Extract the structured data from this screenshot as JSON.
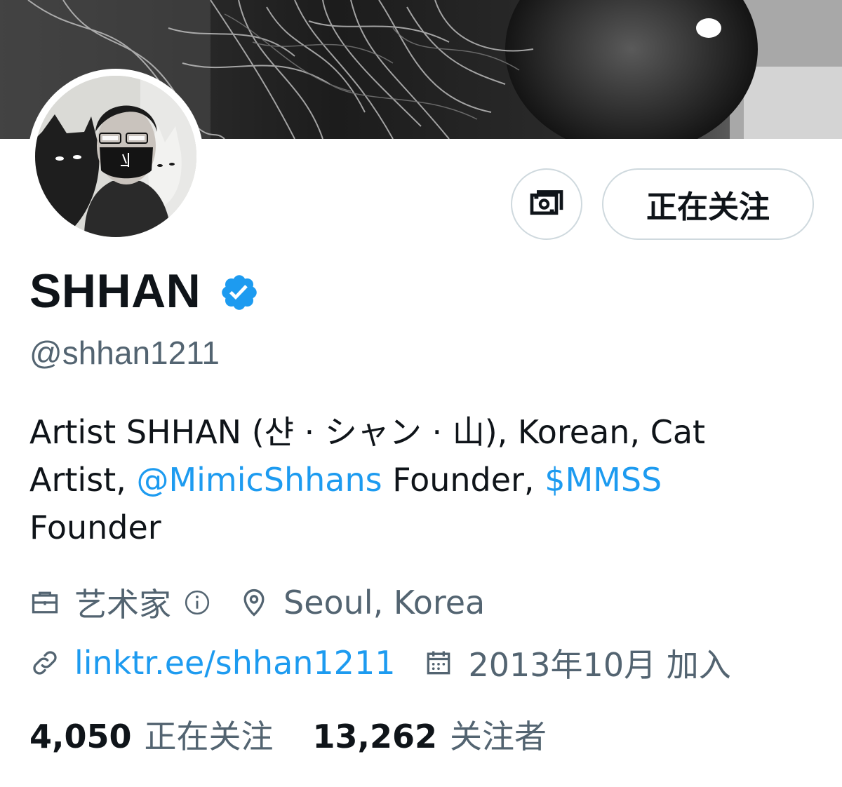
{
  "profile": {
    "display_name": "SHHAN",
    "handle": "@shhan1211",
    "bio": {
      "part1": "Artist SHHAN (샨 · シャン · 山), Korean, Cat Artist, ",
      "mention": "@MimicShhans",
      "part2": " Founder, ",
      "cashtag": "$MMSS",
      "part3": " Founder"
    },
    "profession": "艺术家",
    "location": "Seoul, Korea",
    "website": "linktr.ee/shhan1211",
    "joined": "2013年10月 加入"
  },
  "actions": {
    "tip_icon": "money-icon",
    "follow_label": "正在关注"
  },
  "stats": {
    "following_count": "4,050",
    "following_label": "正在关注",
    "followers_count": "13,262",
    "followers_label": "关注者"
  },
  "colors": {
    "accent": "#1d9bf0",
    "text_primary": "#0f1419",
    "text_secondary": "#536471",
    "border": "#cfd9de"
  }
}
